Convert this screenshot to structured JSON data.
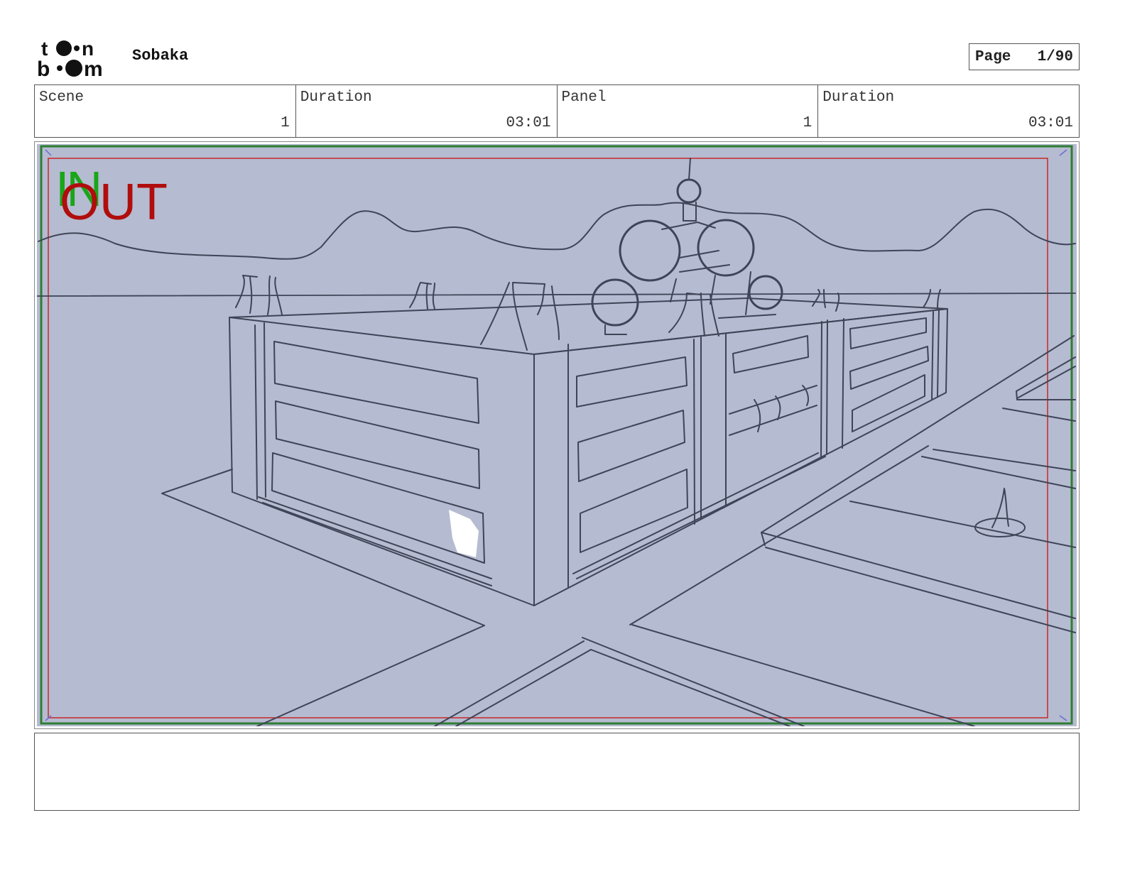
{
  "header": {
    "logo_text": "toon boom",
    "project_title": "Sobaka",
    "page_label": "Page",
    "page_number": "1/90"
  },
  "info": {
    "scene_label": "Scene",
    "scene_value": "1",
    "scene_duration_label": "Duration",
    "scene_duration_value": "03:01",
    "panel_label": "Panel",
    "panel_value": "1",
    "panel_duration_label": "Duration",
    "panel_duration_value": "03:01"
  },
  "panel": {
    "in_marker": "IN",
    "out_marker": "OUT",
    "background_color": "#b5bbd0",
    "safe_frame_color": "#2e7d32",
    "out_frame_color": "#c62828"
  },
  "notes": {
    "text": ""
  }
}
